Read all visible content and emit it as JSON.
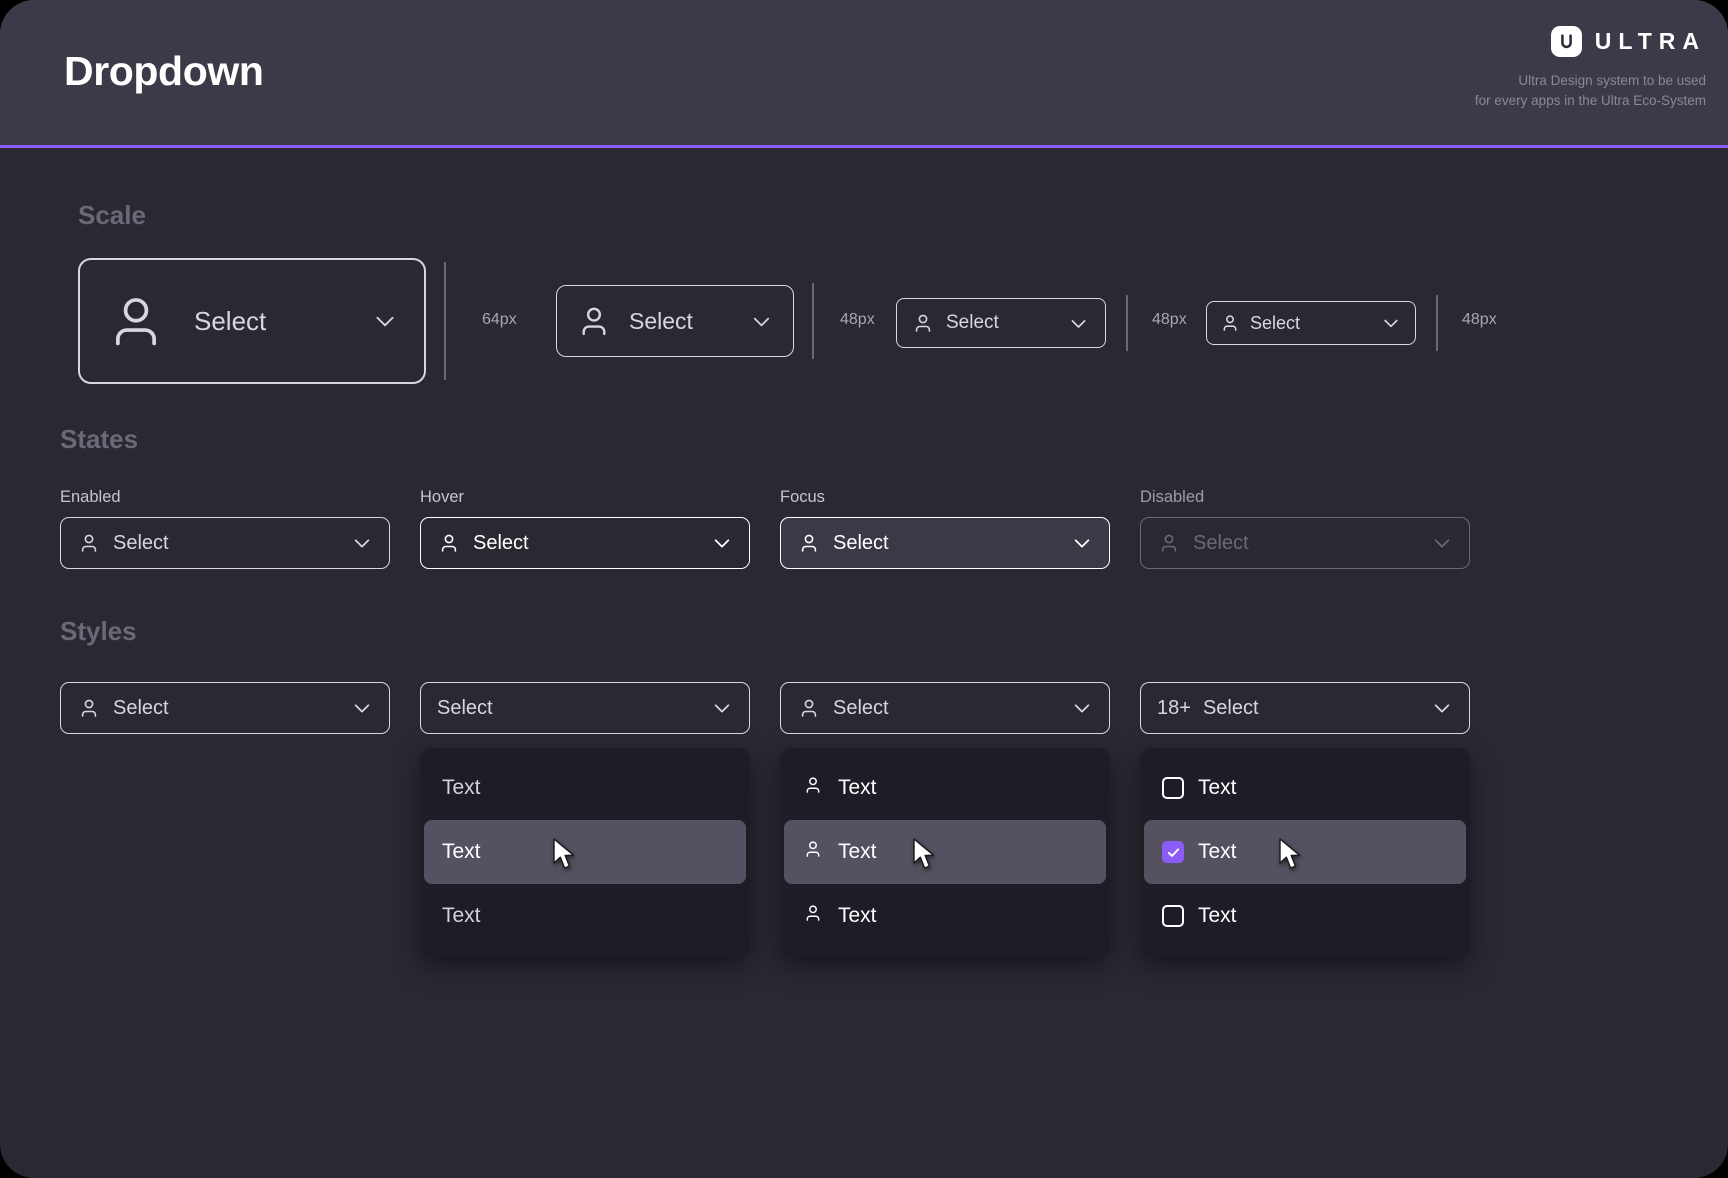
{
  "header": {
    "title": "Dropdown",
    "brand_name": "ULTRA",
    "brand_icon": "ultra-logo-u-icon",
    "tagline": "Ultra Design system to be used\nfor every apps in the Ultra Eco-System"
  },
  "theme": {
    "page_bg": "#2b2832",
    "header_bg": "#3d3949",
    "accent": "#8b5cf6",
    "divider": "#8b5cf6",
    "border_default": "#d9d6de",
    "border_active": "#ffffff",
    "border_disabled": "#6b6878",
    "focus_fill": "#3c3947",
    "panel_bg": "#1e1c26",
    "panel_hover": "#555161",
    "section_title": "#6c6878"
  },
  "sections": {
    "scale": {
      "title": "Scale",
      "items": [
        {
          "label": "Select",
          "icon": "person-icon",
          "chevron": "chevron-down-icon",
          "size_label": "64px"
        },
        {
          "label": "Select",
          "icon": "person-icon",
          "chevron": "chevron-down-icon",
          "size_label": "48px"
        },
        {
          "label": "Select",
          "icon": "person-icon",
          "chevron": "chevron-down-icon",
          "size_label": "48px"
        },
        {
          "label": "Select",
          "icon": "person-icon",
          "chevron": "chevron-down-icon",
          "size_label": "48px"
        }
      ]
    },
    "states": {
      "title": "States",
      "items": [
        {
          "label": "Enabled",
          "value": "Select",
          "icon": "person-icon",
          "chevron": "chevron-down-icon",
          "state": "enabled"
        },
        {
          "label": "Hover",
          "value": "Select",
          "icon": "person-icon",
          "chevron": "chevron-down-icon",
          "state": "hover"
        },
        {
          "label": "Focus",
          "value": "Select",
          "icon": "person-icon",
          "chevron": "chevron-down-icon",
          "state": "focus"
        },
        {
          "label": "Disabled",
          "value": "Select",
          "icon": "person-icon",
          "chevron": "chevron-down-icon",
          "state": "disabled"
        }
      ]
    },
    "styles": {
      "title": "Styles",
      "items": [
        {
          "value": "Select",
          "icon": "person-icon",
          "chevron": "chevron-down-icon",
          "badge": "",
          "open": false,
          "options": []
        },
        {
          "value": "Select",
          "icon": "",
          "chevron": "chevron-down-icon",
          "badge": "",
          "open": true,
          "options": [
            {
              "label": "Text",
              "hovered": false
            },
            {
              "label": "Text",
              "hovered": true
            },
            {
              "label": "Text",
              "hovered": false
            }
          ]
        },
        {
          "value": "Select",
          "icon": "person-icon",
          "chevron": "chevron-down-icon",
          "badge": "",
          "open": true,
          "options": [
            {
              "label": "Text",
              "icon": "person-icon",
              "hovered": false
            },
            {
              "label": "Text",
              "icon": "person-icon",
              "hovered": true
            },
            {
              "label": "Text",
              "icon": "person-icon",
              "hovered": false
            }
          ]
        },
        {
          "value": "Select",
          "icon": "",
          "chevron": "chevron-down-icon",
          "badge": "18+",
          "open": true,
          "options": [
            {
              "label": "Text",
              "checkbox": "unchecked",
              "hovered": false
            },
            {
              "label": "Text",
              "checkbox": "checked",
              "hovered": true
            },
            {
              "label": "Text",
              "checkbox": "unchecked",
              "hovered": false
            }
          ]
        }
      ]
    }
  }
}
